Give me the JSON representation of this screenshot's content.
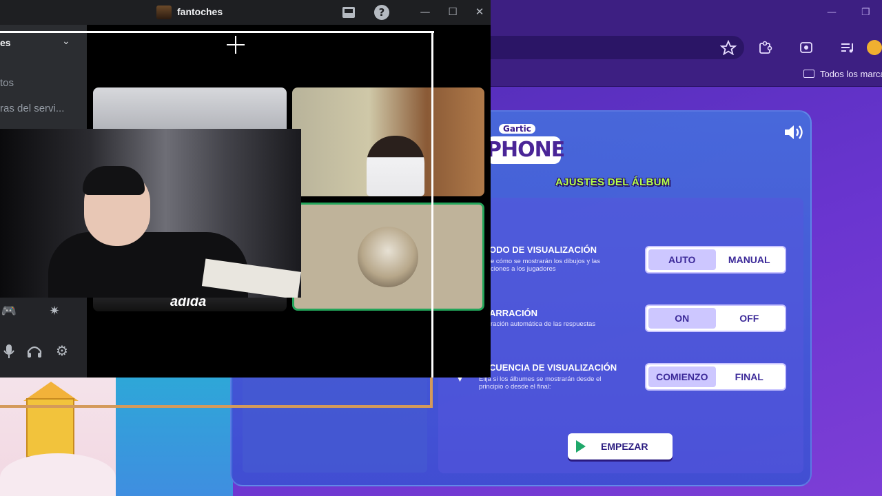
{
  "discord": {
    "window_title": "fantoches",
    "server_name": "es",
    "channels": [
      "tos",
      "ras del servi..."
    ],
    "window_buttons": {
      "inbox": "inbox-icon",
      "help": "?",
      "minimize": "—",
      "maximize": "☐",
      "close": "✕"
    },
    "user_panel": {
      "activity_icon": "🎮",
      "soundboard_icon": "✷",
      "mic_icon": "mic-icon",
      "headset_icon": "headset-icon",
      "settings_icon": "⚙"
    },
    "tiles": {
      "left_shirt_text": "adida"
    }
  },
  "browser": {
    "bookmark_folder": "Todos los marca",
    "toolbar_icons": [
      "star-icon",
      "extensions-icon",
      "screenshot-icon",
      "media-queue-icon",
      "profile-icon"
    ],
    "window_buttons": {
      "minimize": "—",
      "restore": "❐"
    }
  },
  "game": {
    "logo_small": "Gartic",
    "logo_big": "PHONE",
    "panel_title": "AJUSTES DEL ÁLBUM",
    "settings": [
      {
        "title": "ODO DE VISUALIZACIÓN",
        "desc": "e cómo se mostrarán los dibujos y las\nciones a los jugadores",
        "options": [
          "AUTO",
          "MANUAL"
        ],
        "selected": "AUTO"
      },
      {
        "title": "ARRACIÓN",
        "desc": "ración automática de las respuestas",
        "options": [
          "ON",
          "OFF"
        ],
        "selected": "ON"
      },
      {
        "title": "CUENCIA DE VISUALIZACIÓN",
        "desc": "Elija si los álbumes se mostrarán desde el\nprincipio o desde el final:",
        "options": [
          "COMIENZO",
          "FINAL"
        ],
        "selected": "COMIENZO"
      }
    ],
    "start_button": "EMPEZAR",
    "colors": {
      "accent_green": "#b6ff4a",
      "panel_purple": "#5a2bc0",
      "speaking_ring": "#23a55a"
    }
  }
}
